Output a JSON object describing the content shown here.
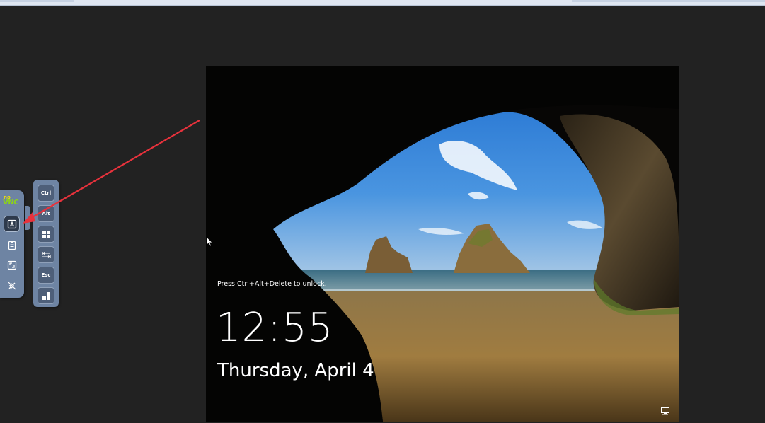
{
  "browser": {
    "title": ""
  },
  "control_bar": {
    "logo": {
      "top": "no",
      "bottom": "VNC"
    },
    "buttons": [
      {
        "name": "keyboard-icon",
        "active": true
      },
      {
        "name": "clipboard-icon",
        "active": false
      },
      {
        "name": "fullscreen-icon",
        "active": false
      },
      {
        "name": "disconnect-icon",
        "active": false
      }
    ]
  },
  "extra_keys": {
    "ctrl": "Ctrl",
    "alt": "Alt",
    "windows": "windows-icon",
    "tab": "tab-icon",
    "esc": "Esc",
    "ctrl_alt_del": "ctrl-alt-del-icon"
  },
  "lock_screen": {
    "hint": "Press Ctrl+Alt+Delete to unlock.",
    "time": "12:55",
    "date": "Thursday, April 4",
    "network_icon": "network-icon"
  },
  "colors": {
    "background": "#222222",
    "panel": "#6e84a3",
    "annotation": "#e8323c",
    "sky": "#2f7fd8",
    "sand": "#9a7a3f"
  }
}
